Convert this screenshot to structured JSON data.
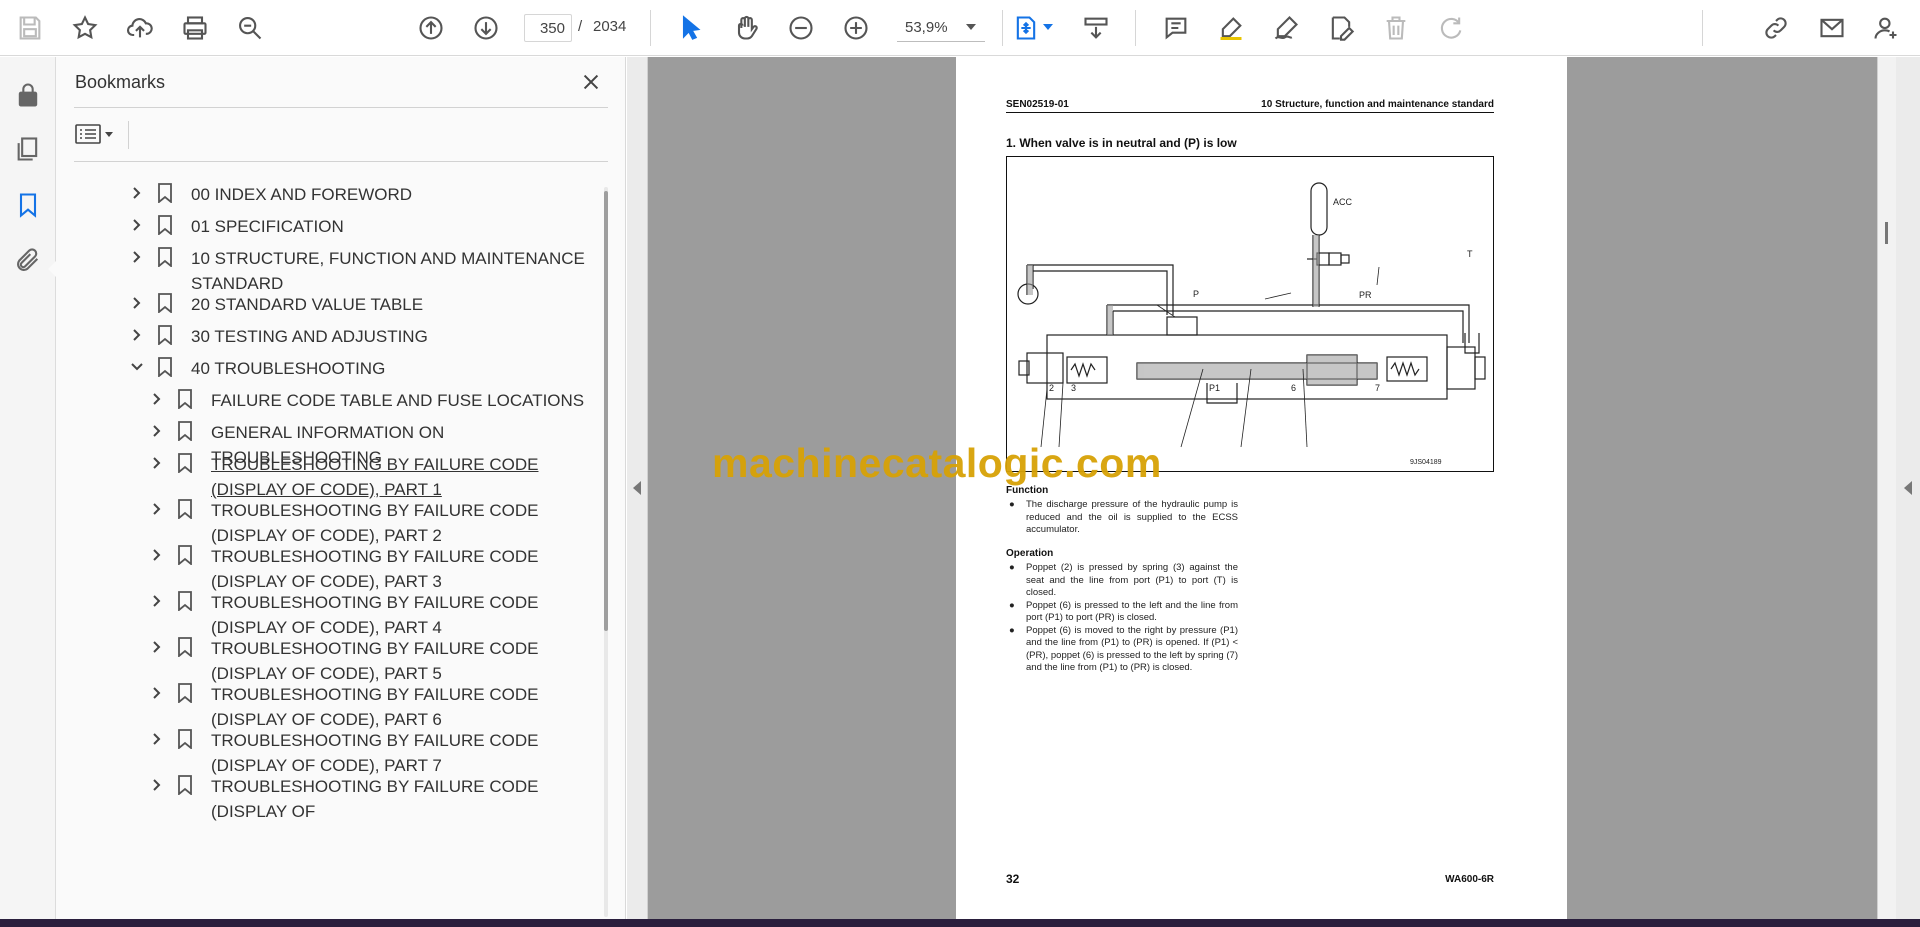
{
  "toolbar": {
    "current_page": "350",
    "page_separator": "/",
    "total_pages": "2034",
    "zoom": "53,9%",
    "icons": [
      "save-icon",
      "star-icon",
      "upload-icon",
      "print-icon",
      "search-zoom-icon",
      "page-up-icon",
      "page-down-icon",
      "zoom-out-icon",
      "zoom-in-icon",
      "select-cursor-icon",
      "hand-icon",
      "fit-page-icon",
      "scroll-mode-icon",
      "comment-icon",
      "highlight-icon",
      "sign-icon",
      "edit-icon",
      "delete-icon",
      "redo-icon",
      "share-link-icon",
      "mail-icon",
      "account-icon"
    ]
  },
  "rail": {
    "icons": [
      "lock-icon",
      "pages-icon",
      "bookmark-icon",
      "attachment-icon"
    ]
  },
  "bookmarks_panel": {
    "title": "Bookmarks",
    "items": [
      {
        "label": "00 INDEX AND FOREWORD",
        "expanded": false,
        "level": 0
      },
      {
        "label": "01 SPECIFICATION",
        "expanded": false,
        "level": 0
      },
      {
        "label": "10 STRUCTURE, FUNCTION AND MAINTENANCE STANDARD",
        "expanded": false,
        "level": 0
      },
      {
        "label": "20 STANDARD VALUE TABLE",
        "expanded": false,
        "level": 0
      },
      {
        "label": "30 TESTING AND ADJUSTING",
        "expanded": false,
        "level": 0
      },
      {
        "label": "40 TROUBLESHOOTING",
        "expanded": true,
        "level": 0
      },
      {
        "label": "FAILURE CODE TABLE AND FUSE LOCATIONS",
        "expanded": false,
        "level": 1
      },
      {
        "label": "GENERAL INFORMATION ON TROUBLESHOOTING",
        "expanded": false,
        "level": 1
      },
      {
        "label": "TROUBLESHOOTING BY FAILURE CODE (DISPLAY OF CODE), PART 1",
        "expanded": false,
        "level": 1,
        "selected": true
      },
      {
        "label": "TROUBLESHOOTING BY FAILURE CODE (DISPLAY OF CODE), PART 2",
        "expanded": false,
        "level": 1
      },
      {
        "label": "TROUBLESHOOTING BY FAILURE CODE (DISPLAY OF CODE), PART 3",
        "expanded": false,
        "level": 1
      },
      {
        "label": "TROUBLESHOOTING BY FAILURE CODE (DISPLAY OF CODE), PART 4",
        "expanded": false,
        "level": 1
      },
      {
        "label": "TROUBLESHOOTING BY FAILURE CODE (DISPLAY OF CODE), PART 5",
        "expanded": false,
        "level": 1
      },
      {
        "label": "TROUBLESHOOTING BY FAILURE CODE (DISPLAY OF CODE), PART 6",
        "expanded": false,
        "level": 1
      },
      {
        "label": "TROUBLESHOOTING BY FAILURE CODE (DISPLAY OF CODE), PART 7",
        "expanded": false,
        "level": 1
      },
      {
        "label": "TROUBLESHOOTING BY FAILURE CODE (DISPLAY OF",
        "expanded": false,
        "level": 1
      }
    ]
  },
  "document": {
    "header_left": "SEN02519-01",
    "header_right": "10 Structure, function and maintenance standard",
    "heading": "1.  When valve is in neutral and (P) is low",
    "diagram_labels": {
      "acc": "ACC",
      "t": "T",
      "p": "P",
      "pr": "PR",
      "n2": "2",
      "n3": "3",
      "p1": "P1",
      "n6": "6",
      "n7": "7",
      "code": "9JS04189"
    },
    "function_title": "Function",
    "function_items": [
      "The discharge pressure of the hydraulic pump is reduced and the oil is supplied to the ECSS accumulator."
    ],
    "operation_title": "Operation",
    "operation_items": [
      "Poppet (2) is pressed by spring (3) against the seat and the line from port (P1) to port (T) is closed.",
      "Poppet (6) is pressed to the left and the line from port (P1) to port (PR) is closed.",
      "Poppet (6) is moved to the right by pressure (P1) and the line from (P1) to (PR) is opened. If (P1) < (PR), poppet (6) is pressed to the left by spring (7) and the line from (P1) to (PR) is closed."
    ],
    "bullet": "●",
    "page_number": "32",
    "model": "WA600-6R"
  },
  "watermark": "machinecatalogic.com",
  "colors": {
    "accent": "#1473e6",
    "watermark": "#d7a206",
    "doc_background": "#9c9c9c"
  }
}
